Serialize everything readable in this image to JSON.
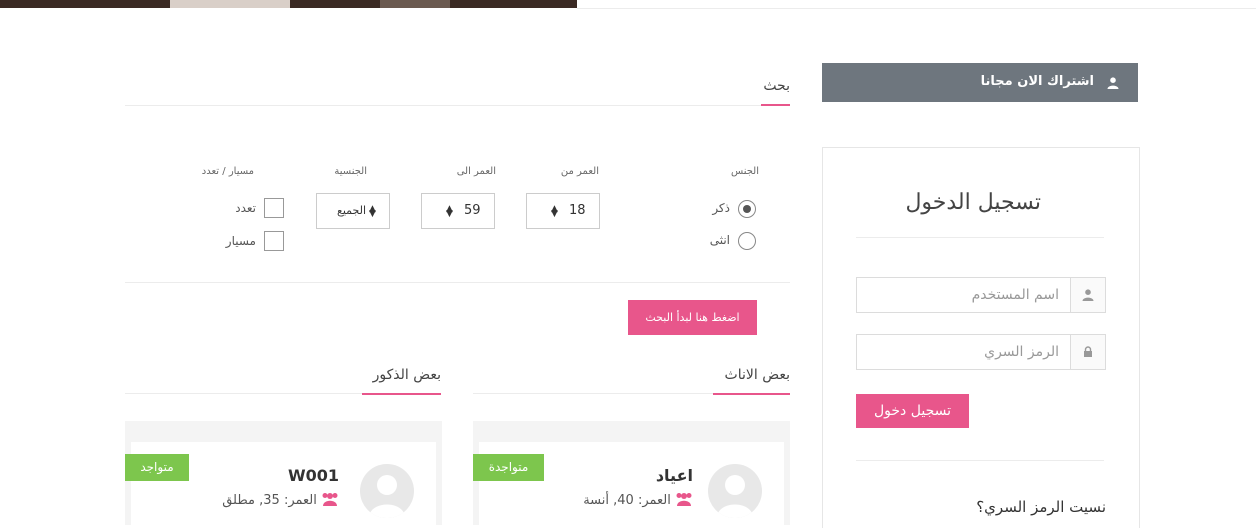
{
  "register": {
    "label": "اشتراك الان مجانا",
    "icon": "user-icon"
  },
  "login": {
    "title": "تسجيل الدخول",
    "username_placeholder": "اسم المستخدم",
    "password_placeholder": "الرمز السري",
    "submit_label": "تسجيل دخول",
    "forgot_label": "نسيت الرمز السري؟"
  },
  "search": {
    "title": "بحث",
    "gender_label": "الجنس",
    "gender_options": [
      "ذكر",
      "انثى"
    ],
    "gender_selected": "ذكر",
    "age_from_label": "العمر من",
    "age_from_value": "18",
    "age_to_label": "العمر الى",
    "age_to_value": "59",
    "nationality_label": "الجنسية",
    "nationality_value": "الجميع",
    "marriage_label": "مسيار / تعدد",
    "marriage_options": [
      "تعدد",
      "مسيار"
    ],
    "submit_label": "اضغط هنا لبدأ البحث"
  },
  "females": {
    "title": "بعض الاناث",
    "members": [
      {
        "name": "اعياد",
        "info": "العمر: 40, أنسة",
        "status": "متواجدة"
      }
    ]
  },
  "males": {
    "title": "بعض الذكور",
    "members": [
      {
        "name": "W001",
        "info": "العمر: 35, مطلق",
        "status": "متواجد"
      }
    ]
  },
  "colors": {
    "accent": "#e8568b",
    "online": "#7dc64d",
    "header_bar": "#6e767e"
  }
}
